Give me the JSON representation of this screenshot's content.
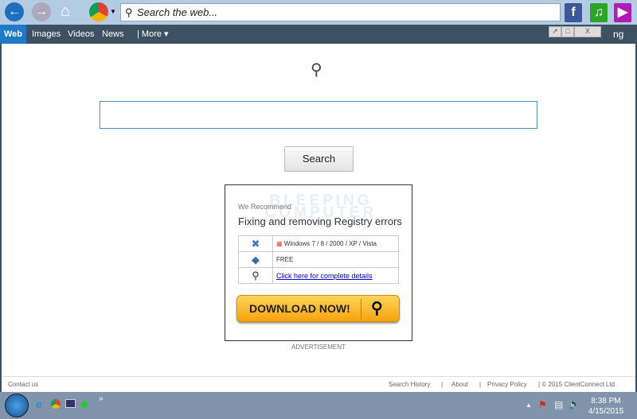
{
  "toolbar": {
    "search_placeholder": "Search the web...",
    "back_icon": "arrow-left-icon",
    "forward_icon": "arrow-right-icon",
    "home_icon": "home-icon",
    "browser_icon": "chrome-icon",
    "social": [
      "facebook-icon",
      "music-icon",
      "video-icon"
    ]
  },
  "nav": {
    "items": [
      "Web",
      "Images",
      "Videos",
      "News",
      "| More ▾"
    ],
    "active": "Web",
    "partial_text": "ng"
  },
  "main": {
    "search_button": "Search"
  },
  "ad": {
    "watermark": "BLEEPING COMPUTER",
    "recommend": "We Recommend",
    "title": "Fixing and removing Registry errors",
    "rows": [
      "Windows 7 / 8 / 2000 / XP / Vista",
      "FREE",
      "Click here for complete details"
    ],
    "download": "DOWNLOAD NOW!",
    "label": "ADVERTISEMENT"
  },
  "footer": {
    "contact": "Contact us",
    "links": [
      "Search History",
      "About",
      "Privacy Policy"
    ],
    "copyright": "© 2015 ClientConnect Ltd"
  },
  "taskbar": {
    "time": "8:38 PM",
    "date": "4/15/2015",
    "more": "»"
  }
}
